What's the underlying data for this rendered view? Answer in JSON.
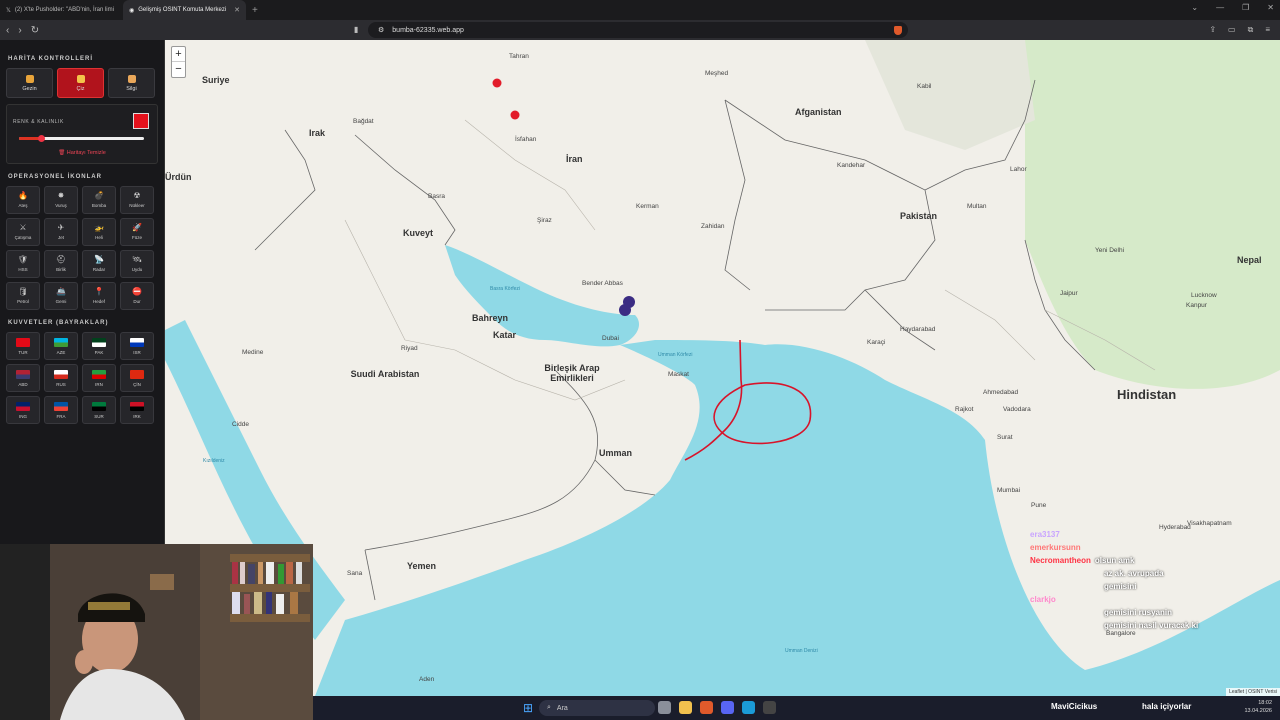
{
  "browser": {
    "tabs": [
      {
        "title": "(2) X'te Pusholder: \"ABD'nin, İran limi",
        "active": false
      },
      {
        "title": "Gelişmiş OSINT Komuta Merkezi",
        "active": true
      }
    ],
    "url": "bumba-62335.web.app"
  },
  "panel": {
    "map_controls_title": "HARİTA KONTROLLERİ",
    "controls": [
      {
        "label": "Gezin",
        "active": false
      },
      {
        "label": "Çiz",
        "active": true
      },
      {
        "label": "Silgi",
        "active": false
      }
    ],
    "color_title": "RENK & KALINLIK",
    "draw_color": "#e4121c",
    "line_width_fraction": 0.18,
    "clear_label": "Haritayı Temizle",
    "icons_title": "OPERASYONEL İKONLAR",
    "icons": [
      {
        "label": "Ateş",
        "glyph": "🔥"
      },
      {
        "label": "Vuruş",
        "glyph": "✸"
      },
      {
        "label": "Bomba",
        "glyph": "💣"
      },
      {
        "label": "Nükleer",
        "glyph": "☢"
      },
      {
        "label": "Çatışma",
        "glyph": "⚔"
      },
      {
        "label": "Jet",
        "glyph": "✈"
      },
      {
        "label": "Heli",
        "glyph": "🚁"
      },
      {
        "label": "Füze",
        "glyph": "🚀"
      },
      {
        "label": "HSS",
        "glyph": "🛡"
      },
      {
        "label": "Birlik",
        "glyph": "⛑"
      },
      {
        "label": "Radar",
        "glyph": "📡"
      },
      {
        "label": "Uydu",
        "glyph": "🛰"
      },
      {
        "label": "Petrol",
        "glyph": "🛢"
      },
      {
        "label": "Gemi",
        "glyph": "🚢"
      },
      {
        "label": "Hedef",
        "glyph": "📍"
      },
      {
        "label": "Dur",
        "glyph": "⛔"
      }
    ],
    "forces_title": "KUVVETLER (BAYRAKLAR)",
    "forces": [
      {
        "label": "TUR",
        "c1": "#e30a17",
        "c2": "#e30a17"
      },
      {
        "label": "AZE",
        "c1": "#00b5e2",
        "c2": "#3f9c35"
      },
      {
        "label": "PAK",
        "c1": "#01411c",
        "c2": "#ffffff"
      },
      {
        "label": "ISR",
        "c1": "#ffffff",
        "c2": "#0038b8"
      },
      {
        "label": "ABD",
        "c1": "#b22234",
        "c2": "#3c3b6e"
      },
      {
        "label": "RUS",
        "c1": "#ffffff",
        "c2": "#d52b1e"
      },
      {
        "label": "IRN",
        "c1": "#239f40",
        "c2": "#da0000"
      },
      {
        "label": "ÇİN",
        "c1": "#de2910",
        "c2": "#de2910"
      },
      {
        "label": "ING",
        "c1": "#012169",
        "c2": "#c8102e"
      },
      {
        "label": "FRA",
        "c1": "#0055a4",
        "c2": "#ef4135"
      },
      {
        "label": "SUR",
        "c1": "#007a3d",
        "c2": "#000000"
      },
      {
        "label": "IRK",
        "c1": "#ce1126",
        "c2": "#000000"
      }
    ]
  },
  "map": {
    "zoom_in": "+",
    "zoom_out": "−",
    "countries": [
      "Suriye",
      "Irak",
      "İran",
      "Afganistan",
      "Pakistan",
      "Kuveyt",
      "Bahreyn",
      "Katar",
      "Suudi Arabistan",
      "Birleşik Arap Emirlikleri",
      "Umman",
      "Yemen",
      "Hindistan",
      "Nepal",
      "Ürdün"
    ],
    "cities": [
      "Tahran",
      "Bağdat",
      "İsfahan",
      "Şiraz",
      "Basra",
      "Kabil",
      "Kandehar",
      "Multan",
      "Lahor",
      "Yeni Delhi",
      "Jaipur",
      "Lucknow",
      "Kanpur",
      "Ahmedabad",
      "Vadodara",
      "Surat",
      "Mumbai",
      "Pune",
      "Hyderabad",
      "Bangalore",
      "Riyad",
      "Medine",
      "Cidde",
      "Sana",
      "Aden",
      "Maskat",
      "Dubai",
      "Karaçi",
      "Haydarabad",
      "Bender Abbas",
      "Kerman",
      "Zahidan",
      "Rajkot",
      "Visakhapatnam",
      "Meşhed"
    ],
    "seas": [
      "Basra Körfezi",
      "Umman Körfezi",
      "Kızıldeniz",
      "Umman Denizi"
    ],
    "markers": [
      {
        "color": "#e21c2a"
      },
      {
        "color": "#e21c2a"
      },
      {
        "color": "#3b2c83"
      },
      {
        "color": "#3b2c83"
      }
    ],
    "attribution": "Leaflet | OSINT Verisi"
  },
  "chat": [
    {
      "user": "era3137",
      "text": "",
      "color": "#c9a4ff"
    },
    {
      "user": "emerkursunn",
      "text": "",
      "color": "#ff7777"
    },
    {
      "user": "Necromantheon",
      "text": "olsun amk",
      "color": "#ff3344"
    },
    {
      "user": "",
      "text": "az ak. avrupada",
      "color": "#fff"
    },
    {
      "user": "",
      "text": "gemisini",
      "color": "#fff"
    },
    {
      "user": "clarkjo",
      "text": "",
      "color": "#ff88cc"
    },
    {
      "user": "",
      "text": "gemisini rusyanin",
      "color": "#fff"
    },
    {
      "user": "",
      "text": "gemisini nasil vuracak ki",
      "color": "#fff"
    },
    {
      "user": "MaviCicikus",
      "text": "hala içiyorlar",
      "color": "#eee"
    }
  ],
  "taskbar": {
    "search": "Ara",
    "time": "18:02",
    "date": "13.04.2026"
  }
}
